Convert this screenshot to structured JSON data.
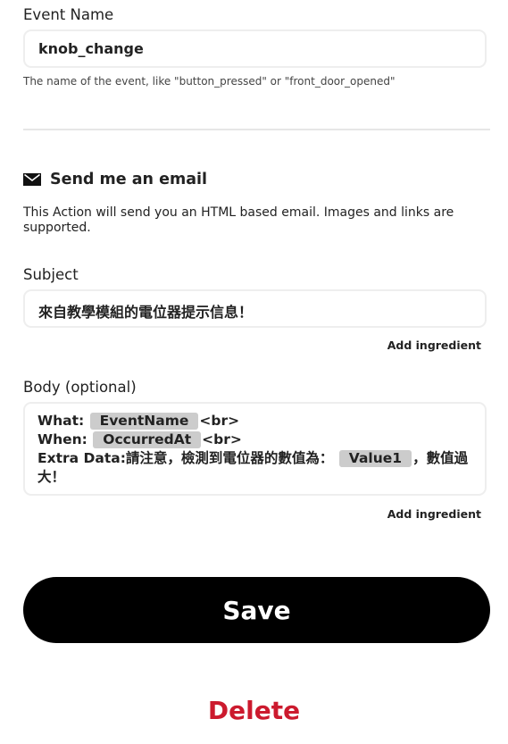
{
  "event_name": {
    "label": "Event Name",
    "value": "knob_change",
    "helper": "The name of the event, like \"button_pressed\" or \"front_door_opened\""
  },
  "action": {
    "icon": "envelope-icon",
    "title": "Send me an email",
    "description": "This Action will send you an HTML based email. Images and links are supported."
  },
  "subject": {
    "label": "Subject",
    "value": "來自教學模組的電位器提示信息！",
    "add_ingredient": "Add ingredient"
  },
  "body": {
    "label": "Body (optional)",
    "line1_prefix": "What: ",
    "line1_chip": "EventName",
    "line1_suffix": "<br>",
    "line2_prefix": "When: ",
    "line2_chip": "OccurredAt",
    "line2_suffix": "<br>",
    "line3_prefix": "Extra Data:請注意，檢測到電位器的數值為：",
    "line3_chip": "Value1",
    "line3_suffix": "，數值過大！",
    "add_ingredient": "Add ingredient"
  },
  "buttons": {
    "save": "Save",
    "delete": "Delete"
  },
  "colors": {
    "save_background": "#000000",
    "delete_text": "#cc1a2e",
    "chip_background": "#cccccc"
  }
}
